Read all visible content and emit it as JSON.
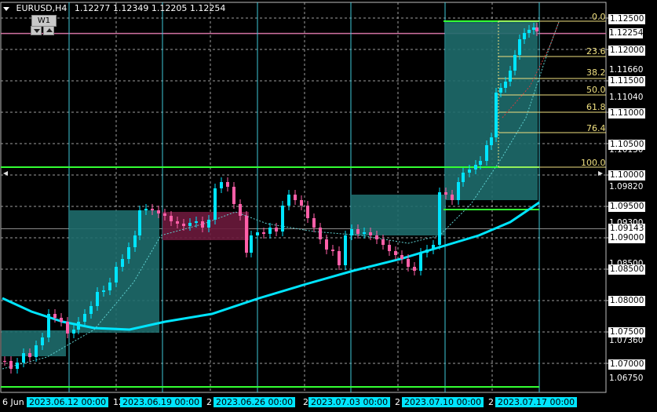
{
  "header": {
    "symbol": "EURUSD,H4",
    "values": "1.12277 1.12349 1.12205 1.12254",
    "timeframe_button": "W1"
  },
  "fib_levels": [
    {
      "label": "0.0"
    },
    {
      "label": "23.6"
    },
    {
      "label": "38.2"
    },
    {
      "label": "50.0"
    },
    {
      "label": "61.8"
    },
    {
      "label": "76.4"
    },
    {
      "label": "100.0"
    }
  ],
  "price_axis": [
    {
      "text": "1.12500",
      "style": "box"
    },
    {
      "text": "1.12254",
      "style": "cur"
    },
    {
      "text": "1.12000",
      "style": "box"
    },
    {
      "text": "1.11660",
      "style": "plain"
    },
    {
      "text": "1.11500",
      "style": "box"
    },
    {
      "text": "1.11040",
      "style": "plain"
    },
    {
      "text": "1.11000",
      "style": "box"
    },
    {
      "text": "1.10130",
      "style": "plain"
    },
    {
      "text": "1.10500",
      "style": "box"
    },
    {
      "text": "1.10000",
      "style": "box"
    },
    {
      "text": "1.09820",
      "style": "plain"
    },
    {
      "text": "1.09500",
      "style": "box"
    },
    {
      "text": "1.09300",
      "style": "plain"
    },
    {
      "text": "1.09143",
      "style": "box"
    },
    {
      "text": "1.09000",
      "style": "box"
    },
    {
      "text": "1.08500",
      "style": "plain"
    },
    {
      "text": "1.08500",
      "style": "box"
    },
    {
      "text": "1.08000",
      "style": "box"
    },
    {
      "text": "1.07500",
      "style": "box"
    },
    {
      "text": "1.07360",
      "style": "plain"
    },
    {
      "text": "1.07000",
      "style": "box"
    },
    {
      "text": "1.06750",
      "style": "plain"
    }
  ],
  "time_axis": [
    {
      "text": "6 Jun",
      "style": "plain"
    },
    {
      "text": "2023.06.12 00:00",
      "style": "box"
    },
    {
      "text": "12",
      "style": "plain"
    },
    {
      "text": "2023.06.19 00:00",
      "style": "box"
    },
    {
      "text": "2",
      "style": "plain"
    },
    {
      "text": "2023.06.26 00:00",
      "style": "box"
    },
    {
      "text": "2",
      "style": "plain"
    },
    {
      "text": "2023.07.03 00:00",
      "style": "box"
    },
    {
      "text": "2",
      "style": "plain"
    },
    {
      "text": "2023.07.10 00:00",
      "style": "box"
    },
    {
      "text": "2",
      "style": "plain"
    },
    {
      "text": "2023.07.17 00:00",
      "style": "box"
    }
  ],
  "colors": {
    "background": "#000000",
    "grid": "#9e9e9e",
    "bull": "#00e5ff",
    "bear": "#ff5fa8",
    "teal_zone": "#1e6b6b",
    "maroon_zone": "#6b1a3c",
    "green_line": "#33ff33",
    "fib": "#f0e080",
    "ma_fast": "#00e5ff"
  }
}
